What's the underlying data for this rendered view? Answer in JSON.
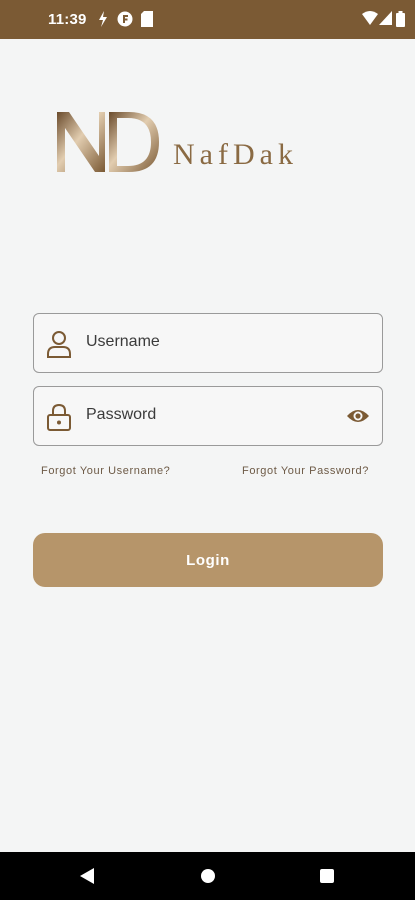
{
  "status_bar": {
    "time": "11:39",
    "icons_left": [
      "flash-icon",
      "notification-f-icon",
      "sim-card-icon"
    ],
    "icons_right": [
      "wifi-icon",
      "signal-icon",
      "battery-icon"
    ]
  },
  "brand": {
    "logo_monogram": "ND",
    "name": "NafDak",
    "color": "#8a6a43"
  },
  "login_form": {
    "username_placeholder": "Username",
    "password_placeholder": "Password",
    "forgot_username": "Forgot Your Username?",
    "forgot_password": "Forgot Your Password?",
    "login_label": "Login"
  },
  "colors": {
    "status_bar": "#7b5a34",
    "accent": "#b6956a",
    "background": "#f4f5f5"
  },
  "nav_bar": {
    "buttons": [
      "back-icon",
      "home-icon",
      "recents-icon"
    ]
  }
}
